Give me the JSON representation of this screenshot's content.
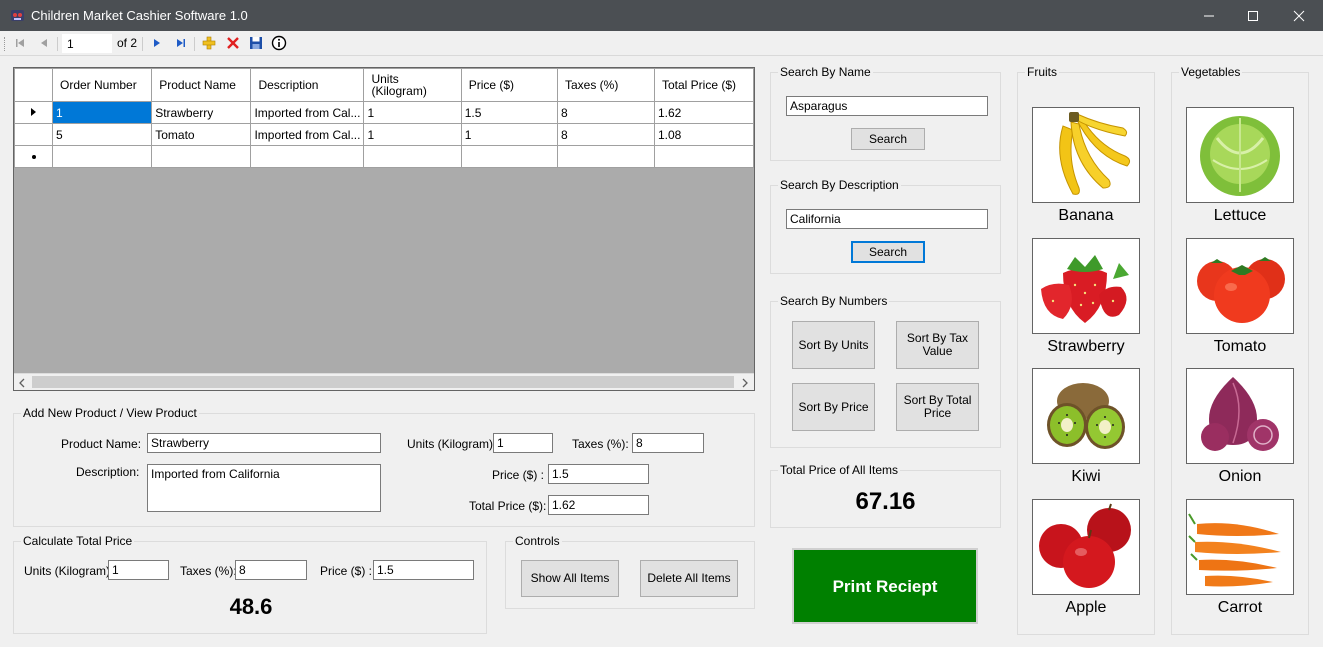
{
  "window": {
    "title": "Children Market Cashier Software 1.0"
  },
  "navigator": {
    "position": "1",
    "count_label": "of 2"
  },
  "grid": {
    "columns": [
      "Order Number",
      "Product Name",
      "Description",
      "Units\n(Kilogram)",
      "Price ($)",
      "Taxes (%)",
      "Total Price ($)"
    ],
    "rows": [
      [
        "1",
        "Strawberry",
        "Imported from Cal...",
        "1",
        "1.5",
        "8",
        "1.62"
      ],
      [
        "5",
        "Tomato",
        "Imported from Cal...",
        "1",
        "1",
        "8",
        "1.08"
      ]
    ]
  },
  "add_product": {
    "legend": "Add New Product / View Product",
    "product_name_label": "Product Name:",
    "product_name_value": "Strawberry",
    "description_label": "Description:",
    "description_value": "Imported from California",
    "units_label": "Units (Kilogram):",
    "units_value": "1",
    "taxes_label": "Taxes (%):",
    "taxes_value": "8",
    "price_label": "Price ($) :",
    "price_value": "1.5",
    "total_label": "Total Price ($):",
    "total_value": "1.62"
  },
  "calc": {
    "legend": "Calculate Total Price",
    "units_label": "Units (Kilogram):",
    "units_value": "1",
    "taxes_label": "Taxes (%):",
    "taxes_value": "8",
    "price_label": "Price ($) :",
    "price_value": "1.5",
    "result": "48.6"
  },
  "controls": {
    "legend": "Controls",
    "show_all": "Show All Items",
    "delete_all": "Delete All Items"
  },
  "search_name": {
    "legend": "Search By Name",
    "value": "Asparagus",
    "button": "Search"
  },
  "search_desc": {
    "legend": "Search By Description",
    "value": "California",
    "button": "Search"
  },
  "search_numbers": {
    "legend": "Search By Numbers",
    "sort_units": "Sort By Units",
    "sort_tax": "Sort By Tax Value",
    "sort_price": "Sort By Price",
    "sort_total": "Sort By Total Price"
  },
  "total_all": {
    "legend": "Total Price of All Items",
    "value": "67.16"
  },
  "print_button": "Print Reciept",
  "fruits": {
    "legend": "Fruits",
    "items": [
      "Banana",
      "Strawberry",
      "Kiwi",
      "Apple"
    ]
  },
  "vegetables": {
    "legend": "Vegetables",
    "items": [
      "Lettuce",
      "Tomato",
      "Onion",
      "Carrot"
    ]
  },
  "colors": {
    "titlebar": "#4b4f53",
    "selection": "#0078d7",
    "print_button": "#008000"
  }
}
